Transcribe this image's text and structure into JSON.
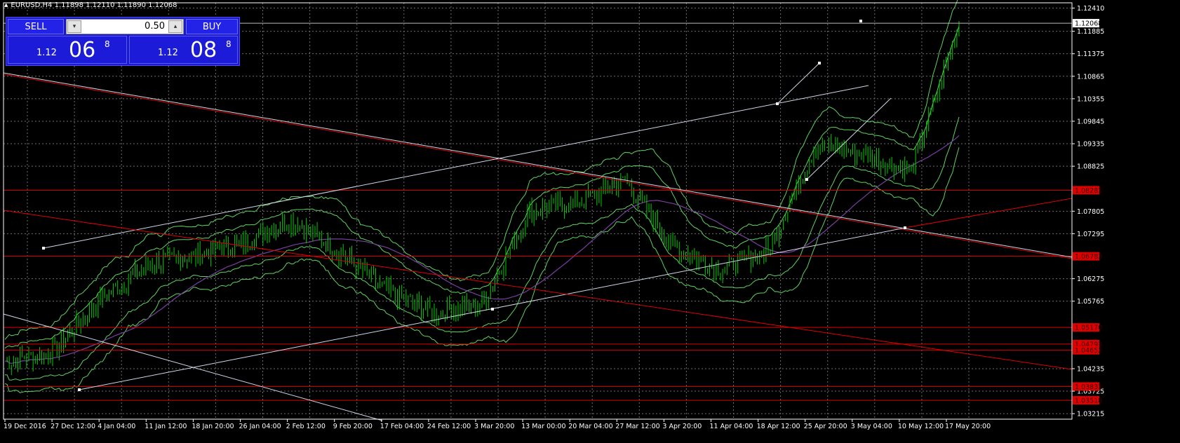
{
  "window": {
    "title": "EURUSD,H4  1.11898 1.12110 1.11890 1.12068"
  },
  "trade_panel": {
    "sell_label": "SELL",
    "buy_label": "BUY",
    "lot_value": "0.50",
    "sell_price": {
      "prefix": "1.12",
      "big": "06",
      "sup": "8"
    },
    "buy_price": {
      "prefix": "1.12",
      "big": "08",
      "sup": "8"
    }
  },
  "price_axis": {
    "ticks": [
      "1.12410",
      "1.11885",
      "1.11375",
      "1.10865",
      "1.10355",
      "1.09845",
      "1.09335",
      "1.08825",
      "1.07805",
      "1.07295",
      "1.06275",
      "1.05765",
      "1.04235",
      "1.03725",
      "1.03215"
    ],
    "current_tag": "1.12068",
    "line_tags": [
      "1.08281",
      "1.06783",
      "1.05170",
      "1.04793",
      "1.04652",
      "1.03831",
      "1.03518"
    ]
  },
  "time_axis": {
    "labels": [
      "19 Dec 2016",
      "27 Dec 12:00",
      "4 Jan 04:00",
      "11 Jan 12:00",
      "18 Jan 20:00",
      "26 Jan 04:00",
      "2 Feb 12:00",
      "9 Feb 20:00",
      "17 Feb 04:00",
      "24 Feb 12:00",
      "3 Mar 20:00",
      "13 Mar 00:00",
      "20 Mar 04:00",
      "27 Mar 12:00",
      "3 Apr 20:00",
      "11 Apr 04:00",
      "18 Apr 12:00",
      "25 Apr 20:00",
      "3 May 04:00",
      "10 May 12:00",
      "17 May 20:00"
    ]
  },
  "colors": {
    "background": "#000000",
    "grid": "#6e6e6e",
    "candles": "#00cc00",
    "bands": "#5fd35f",
    "level_line": "#e00000",
    "trend_white": "#cfd8ea",
    "moving_avg": "#7b3fa0",
    "panel_blue": "#1a1acc"
  },
  "chart_data": {
    "type": "line",
    "symbol": "EURUSD",
    "timeframe": "H4",
    "ylim": [
      1.0309,
      1.1253
    ],
    "x": [
      "19 Dec 2016",
      "27 Dec 12:00",
      "4 Jan 04:00",
      "11 Jan 12:00",
      "18 Jan 20:00",
      "26 Jan 04:00",
      "2 Feb 12:00",
      "9 Feb 20:00",
      "17 Feb 04:00",
      "24 Feb 12:00",
      "3 Mar 20:00",
      "13 Mar 00:00",
      "20 Mar 04:00",
      "27 Mar 12:00",
      "3 Apr 20:00",
      "11 Apr 04:00",
      "18 Apr 12:00",
      "25 Apr 20:00",
      "3 May 04:00",
      "10 May 12:00",
      "17 May 20:00"
    ],
    "series": [
      {
        "values": [
          1.044,
          1.046,
          1.058,
          1.066,
          1.068,
          1.071,
          1.076,
          1.069,
          1.06,
          1.055,
          1.057,
          1.078,
          1.08,
          1.085,
          1.07,
          1.065,
          1.069,
          1.093,
          1.091,
          1.087,
          1.12
        ]
      }
    ],
    "horizontal_levels": [
      1.08281,
      1.06783,
      1.0517,
      1.04793,
      1.04652,
      1.03831,
      1.03518
    ],
    "current_price": 1.12068
  }
}
